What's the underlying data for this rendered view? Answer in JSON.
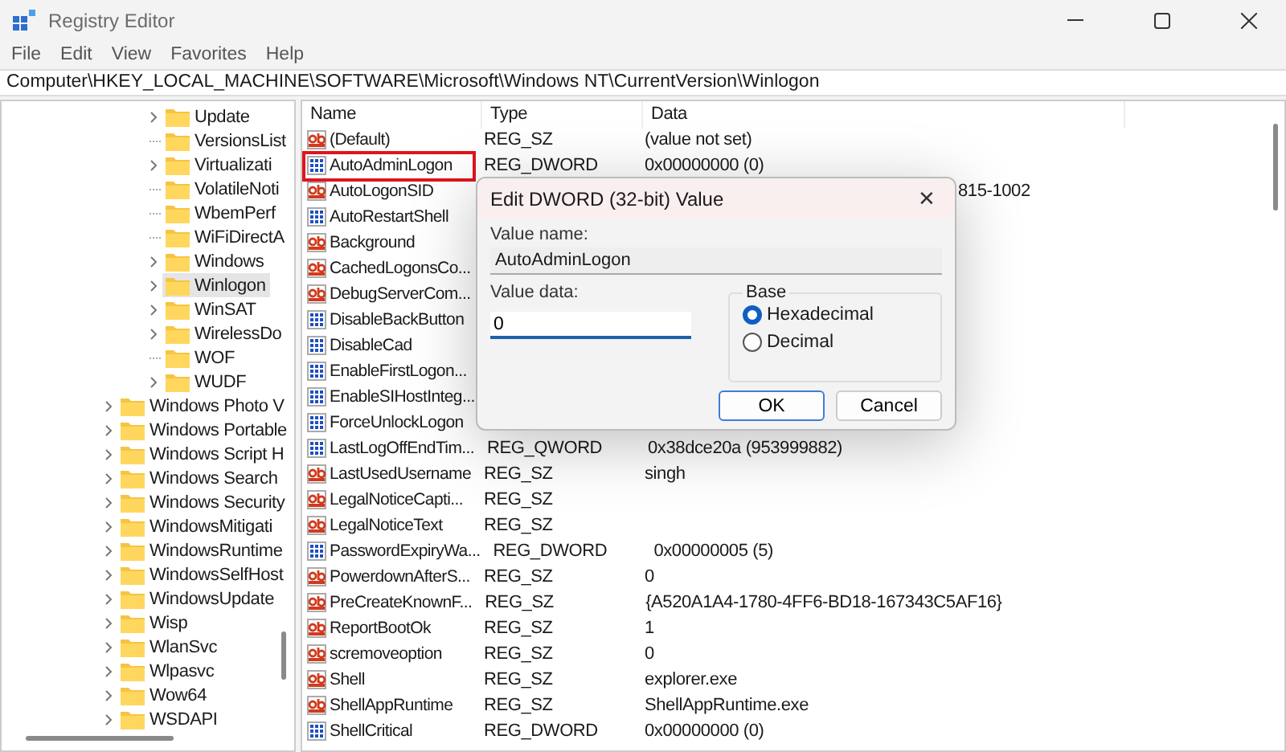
{
  "window": {
    "title": "Registry Editor"
  },
  "menu": [
    "File",
    "Edit",
    "View",
    "Favorites",
    "Help"
  ],
  "address": "Computer\\HKEY_LOCAL_MACHINE\\SOFTWARE\\Microsoft\\Windows NT\\CurrentVersion\\Winlogon",
  "tree": {
    "nested_items": [
      {
        "label": "Update",
        "expandable": true,
        "selected": false
      },
      {
        "label": "VersionsList",
        "expandable": false,
        "selected": false
      },
      {
        "label": "Virtualizati",
        "expandable": true,
        "selected": false
      },
      {
        "label": "VolatileNoti",
        "expandable": false,
        "selected": false
      },
      {
        "label": "WbemPerf",
        "expandable": false,
        "selected": false
      },
      {
        "label": "WiFiDirectA",
        "expandable": false,
        "selected": false
      },
      {
        "label": "Windows",
        "expandable": true,
        "selected": false
      },
      {
        "label": "Winlogon",
        "expandable": true,
        "selected": true
      },
      {
        "label": "WinSAT",
        "expandable": true,
        "selected": false
      },
      {
        "label": "WirelessDo",
        "expandable": true,
        "selected": false
      },
      {
        "label": "WOF",
        "expandable": false,
        "selected": false
      },
      {
        "label": "WUDF",
        "expandable": true,
        "selected": false
      }
    ],
    "items": [
      {
        "label": "Windows Photo V",
        "expandable": true,
        "selected": false
      },
      {
        "label": "Windows Portable",
        "expandable": true,
        "selected": false
      },
      {
        "label": "Windows Script H",
        "expandable": true,
        "selected": false
      },
      {
        "label": "Windows Search",
        "expandable": true,
        "selected": false
      },
      {
        "label": "Windows Security",
        "expandable": true,
        "selected": false
      },
      {
        "label": "WindowsMitigati",
        "expandable": true,
        "selected": false
      },
      {
        "label": "WindowsRuntime",
        "expandable": true,
        "selected": false
      },
      {
        "label": "WindowsSelfHost",
        "expandable": true,
        "selected": false
      },
      {
        "label": "WindowsUpdate",
        "expandable": true,
        "selected": false
      },
      {
        "label": "Wisp",
        "expandable": true,
        "selected": false
      },
      {
        "label": "WlanSvc",
        "expandable": true,
        "selected": false
      },
      {
        "label": "Wlpasvc",
        "expandable": true,
        "selected": false
      },
      {
        "label": "Wow64",
        "expandable": true,
        "selected": false
      },
      {
        "label": "WSDAPI",
        "expandable": true,
        "selected": false
      }
    ]
  },
  "table": {
    "columns": [
      "Name",
      "Type",
      "Data"
    ],
    "rows": [
      {
        "kind": "string",
        "name": "(Default)",
        "type": "REG_SZ",
        "data": "(value not set)",
        "highlighted": false
      },
      {
        "kind": "binary",
        "name": "AutoAdminLogon",
        "type": "REG_DWORD",
        "data": "0x00000000 (0)",
        "highlighted": true
      },
      {
        "kind": "string",
        "name": "AutoLogonSID",
        "data": "815-1002",
        "highlighted": false
      },
      {
        "kind": "binary",
        "name": "AutoRestartShell",
        "highlighted": false
      },
      {
        "kind": "string",
        "name": "Background",
        "highlighted": false
      },
      {
        "kind": "string",
        "name": "CachedLogonsCo...",
        "highlighted": false
      },
      {
        "kind": "string",
        "name": "DebugServerCom...",
        "highlighted": false
      },
      {
        "kind": "binary",
        "name": "DisableBackButton",
        "highlighted": false
      },
      {
        "kind": "binary",
        "name": "DisableCad",
        "highlighted": false
      },
      {
        "kind": "binary",
        "name": "EnableFirstLogon...",
        "highlighted": false
      },
      {
        "kind": "binary",
        "name": "EnableSIHostInteg...",
        "highlighted": false
      },
      {
        "kind": "binary",
        "name": "ForceUnlockLogon",
        "highlighted": false
      },
      {
        "kind": "binary",
        "name": "LastLogOffEndTim...",
        "type": "REG_QWORD",
        "data": "0x38dce20a (953999882)",
        "highlighted": false
      },
      {
        "kind": "string",
        "name": "LastUsedUsername",
        "type": "REG_SZ",
        "data": "singh",
        "highlighted": false
      },
      {
        "kind": "string",
        "name": "LegalNoticeCapti...",
        "type": "REG_SZ",
        "highlighted": false
      },
      {
        "kind": "string",
        "name": "LegalNoticeText",
        "type": "REG_SZ",
        "highlighted": false
      },
      {
        "kind": "binary",
        "name": "PasswordExpiryWa...",
        "type": "REG_DWORD",
        "data": "0x00000005 (5)",
        "highlighted": false
      },
      {
        "kind": "string",
        "name": "PowerdownAfterS...",
        "type": "REG_SZ",
        "data": "0",
        "highlighted": false
      },
      {
        "kind": "string",
        "name": "PreCreateKnownF...",
        "type": "REG_SZ",
        "data": "{A520A1A4-1780-4FF6-BD18-167343C5AF16}",
        "highlighted": false
      },
      {
        "kind": "string",
        "name": "ReportBootOk",
        "type": "REG_SZ",
        "data": "1",
        "highlighted": false
      },
      {
        "kind": "string",
        "name": "scremoveoption",
        "type": "REG_SZ",
        "data": "0",
        "highlighted": false
      },
      {
        "kind": "string",
        "name": "Shell",
        "type": "REG_SZ",
        "data": "explorer.exe",
        "highlighted": false
      },
      {
        "kind": "string",
        "name": "ShellAppRuntime",
        "type": "REG_SZ",
        "data": "ShellAppRuntime.exe",
        "highlighted": false
      },
      {
        "kind": "binary",
        "name": "ShellCritical",
        "type": "REG_DWORD",
        "data": "0x00000000 (0)",
        "highlighted": false
      }
    ]
  },
  "dialog": {
    "title": "Edit DWORD (32-bit) Value",
    "close": "✕",
    "value_name_label": "Value name:",
    "value_name": "AutoAdminLogon",
    "value_data_label": "Value data:",
    "value_data": "0",
    "base_label": "Base",
    "bases": [
      {
        "label": "Hexadecimal",
        "selected": true
      },
      {
        "label": "Decimal",
        "selected": false
      }
    ],
    "buttons": [
      {
        "label": "OK",
        "default": true
      },
      {
        "label": "Cancel",
        "default": false
      }
    ]
  }
}
